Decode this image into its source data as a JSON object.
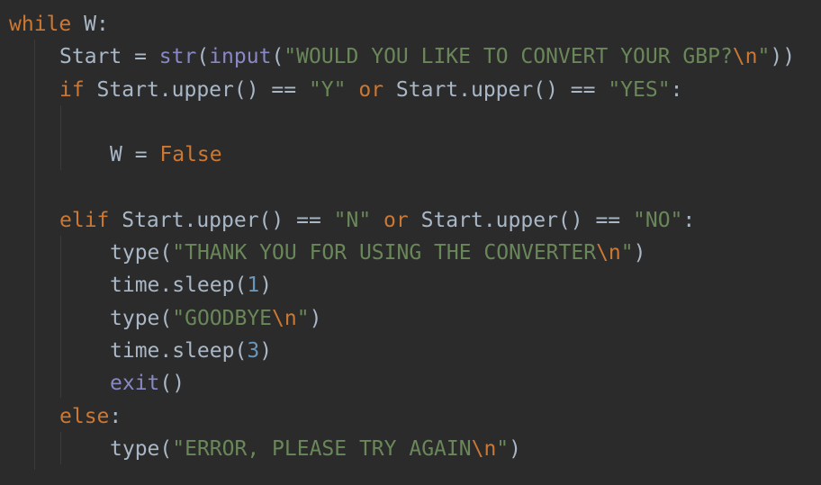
{
  "colors": {
    "background": "#2b2b2b",
    "text": "#a9b7c6",
    "keyword": "#cc7832",
    "builtin": "#8888c6",
    "string": "#6a8759",
    "number": "#6897bb",
    "indent_guide": "#3b3b3b"
  },
  "code": {
    "lines": [
      {
        "indent": 0,
        "tokens": [
          {
            "t": "while",
            "c": "kw"
          },
          {
            "t": " W:",
            "c": "plain"
          }
        ]
      },
      {
        "indent": 1,
        "tokens": [
          {
            "t": "Start = ",
            "c": "plain"
          },
          {
            "t": "str",
            "c": "builtin"
          },
          {
            "t": "(",
            "c": "plain"
          },
          {
            "t": "input",
            "c": "builtin"
          },
          {
            "t": "(",
            "c": "plain"
          },
          {
            "t": "\"WOULD YOU LIKE TO CONVERT YOUR GBP?",
            "c": "str"
          },
          {
            "t": "\\n",
            "c": "esc"
          },
          {
            "t": "\"",
            "c": "str"
          },
          {
            "t": "))",
            "c": "plain"
          }
        ]
      },
      {
        "indent": 1,
        "tokens": [
          {
            "t": "if",
            "c": "kw"
          },
          {
            "t": " Start.upper() == ",
            "c": "plain"
          },
          {
            "t": "\"Y\"",
            "c": "str"
          },
          {
            "t": " ",
            "c": "plain"
          },
          {
            "t": "or",
            "c": "kw"
          },
          {
            "t": " Start.upper() == ",
            "c": "plain"
          },
          {
            "t": "\"YES\"",
            "c": "str"
          },
          {
            "t": ":",
            "c": "plain"
          }
        ]
      },
      {
        "indent": 0,
        "tokens": []
      },
      {
        "indent": 2,
        "tokens": [
          {
            "t": "W = ",
            "c": "plain"
          },
          {
            "t": "False",
            "c": "kw"
          }
        ]
      },
      {
        "indent": 0,
        "tokens": []
      },
      {
        "indent": 1,
        "tokens": [
          {
            "t": "elif",
            "c": "kw"
          },
          {
            "t": " Start.upper() == ",
            "c": "plain"
          },
          {
            "t": "\"N\"",
            "c": "str"
          },
          {
            "t": " ",
            "c": "plain"
          },
          {
            "t": "or",
            "c": "kw"
          },
          {
            "t": " Start.upper() == ",
            "c": "plain"
          },
          {
            "t": "\"NO\"",
            "c": "str"
          },
          {
            "t": ":",
            "c": "plain"
          }
        ]
      },
      {
        "indent": 2,
        "tokens": [
          {
            "t": "type(",
            "c": "plain"
          },
          {
            "t": "\"THANK YOU FOR USING THE CONVERTER",
            "c": "str"
          },
          {
            "t": "\\n",
            "c": "esc"
          },
          {
            "t": "\"",
            "c": "str"
          },
          {
            "t": ")",
            "c": "plain"
          }
        ]
      },
      {
        "indent": 2,
        "tokens": [
          {
            "t": "time.sleep(",
            "c": "plain"
          },
          {
            "t": "1",
            "c": "num"
          },
          {
            "t": ")",
            "c": "plain"
          }
        ]
      },
      {
        "indent": 2,
        "tokens": [
          {
            "t": "type(",
            "c": "plain"
          },
          {
            "t": "\"GOODBYE",
            "c": "str"
          },
          {
            "t": "\\n",
            "c": "esc"
          },
          {
            "t": "\"",
            "c": "str"
          },
          {
            "t": ")",
            "c": "plain"
          }
        ]
      },
      {
        "indent": 2,
        "tokens": [
          {
            "t": "time.sleep(",
            "c": "plain"
          },
          {
            "t": "3",
            "c": "num"
          },
          {
            "t": ")",
            "c": "plain"
          }
        ]
      },
      {
        "indent": 2,
        "tokens": [
          {
            "t": "exit",
            "c": "builtin"
          },
          {
            "t": "()",
            "c": "plain"
          }
        ]
      },
      {
        "indent": 1,
        "tokens": [
          {
            "t": "else",
            "c": "kw"
          },
          {
            "t": ":",
            "c": "plain"
          }
        ]
      },
      {
        "indent": 2,
        "tokens": [
          {
            "t": "type(",
            "c": "plain"
          },
          {
            "t": "\"ERROR, PLEASE TRY AGAIN",
            "c": "str"
          },
          {
            "t": "\\n",
            "c": "esc"
          },
          {
            "t": "\"",
            "c": "str"
          },
          {
            "t": ")",
            "c": "plain"
          }
        ]
      }
    ]
  }
}
